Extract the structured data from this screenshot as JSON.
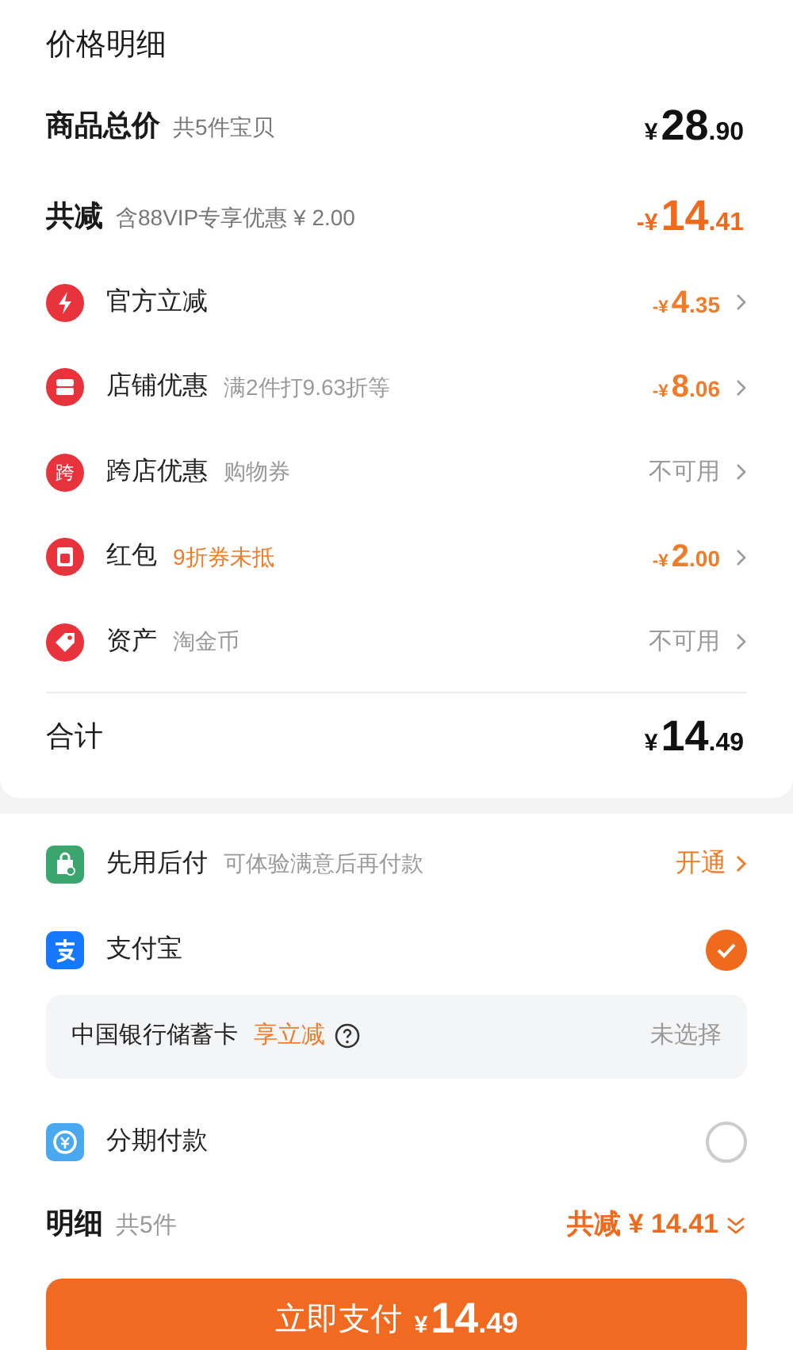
{
  "title": "价格明细",
  "subtotal": {
    "label": "商品总价",
    "note": "共5件宝贝",
    "amount": "¥28.90"
  },
  "discount_total": {
    "label": "共减",
    "note": "含88VIP专享优惠 ¥ 2.00",
    "amount": "-¥14.41"
  },
  "discounts": [
    {
      "label": "官方立减",
      "kind": "amount",
      "value": "-¥4.35"
    },
    {
      "label": "店铺优惠",
      "note": "满2件打9.63折等",
      "kind": "amount",
      "value": "-¥8.06"
    },
    {
      "icon_text": "跨",
      "label": "跨店优惠",
      "note": "购物券",
      "kind": "text",
      "value": "不可用"
    },
    {
      "label": "红包",
      "note": "9折券未抵",
      "note_highlight": true,
      "kind": "amount",
      "value": "-¥2.00"
    },
    {
      "label": "资产",
      "note": "淘金币",
      "kind": "text",
      "value": "不可用"
    }
  ],
  "total": {
    "label": "合计",
    "amount": "¥14.49"
  },
  "pay_later": {
    "label": "先用后付",
    "note": "可体验满意后再付款",
    "action": "开通"
  },
  "payment_methods": [
    {
      "label": "支付宝",
      "selected": true,
      "card": {
        "name": "中国银行储蓄卡",
        "promo": "享立减",
        "status": "未选择"
      }
    },
    {
      "label": "分期付款",
      "selected": false
    }
  ],
  "summary": {
    "label": "明细",
    "count": "共5件",
    "discount": "共减 ¥ 14.41"
  },
  "pay_button": {
    "label": "立即支付",
    "amount": "¥14.49"
  }
}
